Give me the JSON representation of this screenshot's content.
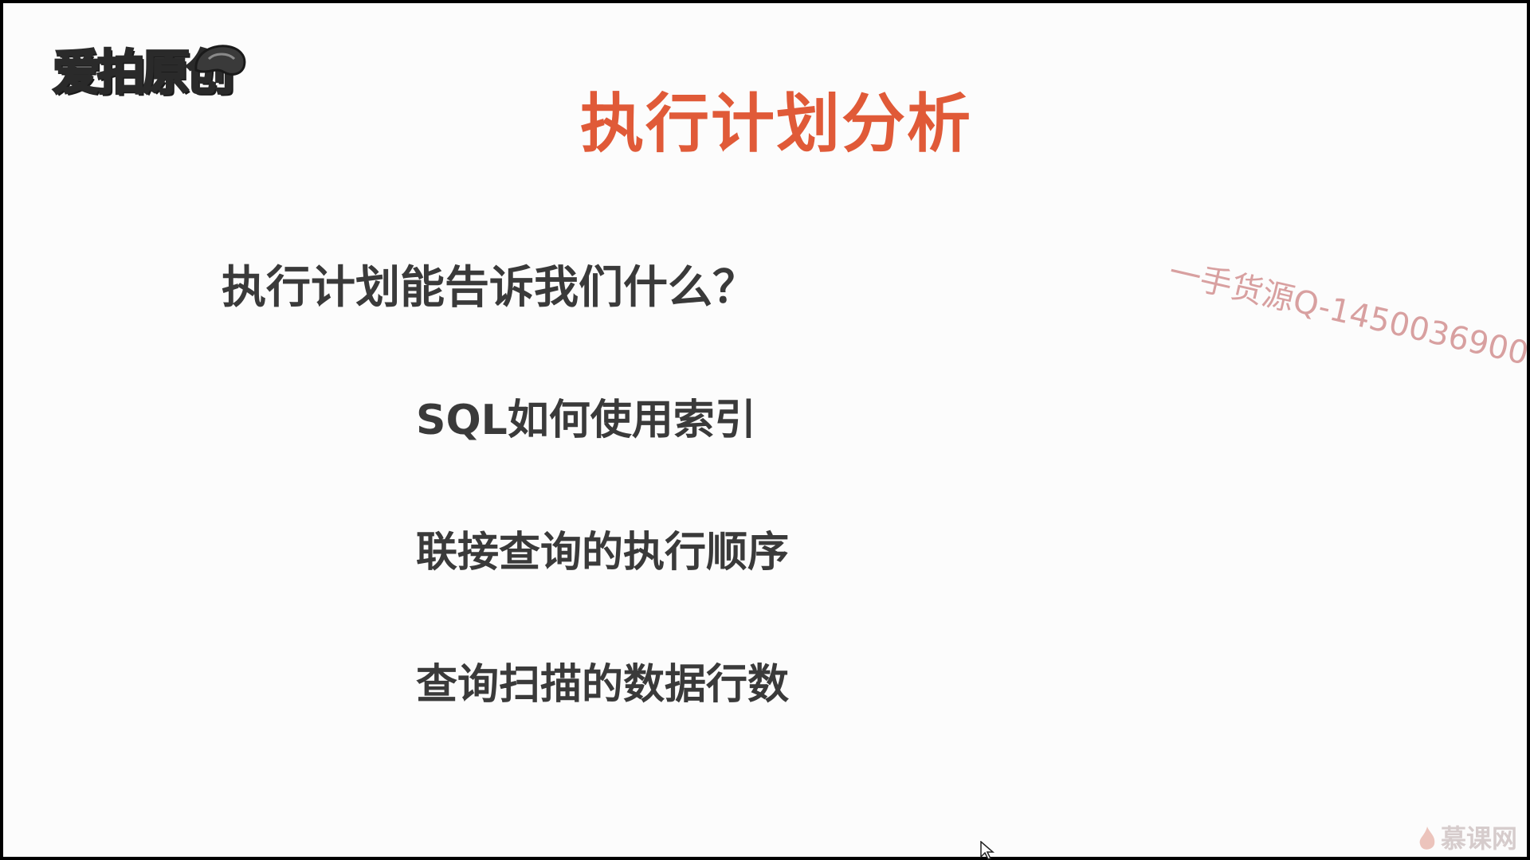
{
  "logo": {
    "text": "爱拍原创",
    "icon": "gamepad-cap-icon"
  },
  "slide": {
    "title": "执行计划分析",
    "question": "执行计划能告诉我们什么？",
    "bullets": [
      "SQL如何使用索引",
      "联接查询的执行顺序",
      "查询扫描的数据行数"
    ]
  },
  "watermark": {
    "text": "一手货源Q-1450036900"
  },
  "brand": {
    "text": "慕课网",
    "icon": "flame-icon"
  },
  "cursor": {
    "icon": "mouse-pointer-icon"
  },
  "colors": {
    "title": "#e05a38",
    "text": "#3a3a3a",
    "background": "#fcfcfc",
    "watermark": "#d8a0a0"
  }
}
